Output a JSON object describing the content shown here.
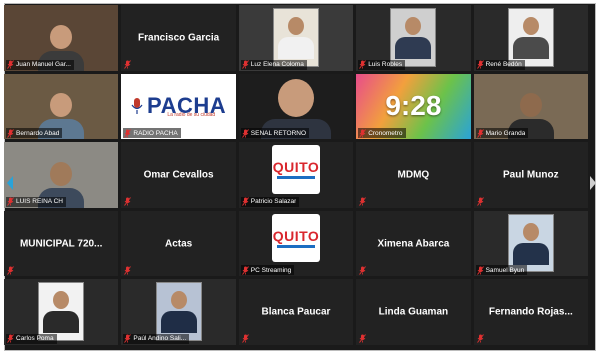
{
  "colors": {
    "tile_bg": "#222222",
    "frame_bg": "#1a1a1a",
    "mic_muted": "#e03131",
    "accent_nav": "#2aa3d8"
  },
  "icons": {
    "muted": "muted-mic-icon",
    "prev": "chevron-left-icon",
    "next": "chevron-right-icon"
  },
  "participants": [
    {
      "label": "Juan Manuel Gar...",
      "kind": "video"
    },
    {
      "name": "Francisco Garcia",
      "kind": "name"
    },
    {
      "label": "Luz Elena Coloma",
      "kind": "video"
    },
    {
      "label": "Luis Robles",
      "kind": "video"
    },
    {
      "label": "René Bedón",
      "kind": "video"
    },
    {
      "label": "Bernardo Abad",
      "kind": "video"
    },
    {
      "label": "RADIO PACHA",
      "kind": "logo",
      "logo": "PACHA",
      "logo_sub": "La radio de su ciudad"
    },
    {
      "label": "SEÑAL RETORNO",
      "kind": "video"
    },
    {
      "label": "Cronometro",
      "kind": "clock",
      "time": "9:28"
    },
    {
      "label": "Mario Granda",
      "kind": "video"
    },
    {
      "label": "LUIS REINA CH",
      "kind": "video"
    },
    {
      "name": "Omar Cevallos",
      "kind": "name"
    },
    {
      "label": "Patricio Salazar",
      "kind": "logo",
      "logo": "QUITO"
    },
    {
      "name": "MDMQ",
      "kind": "name"
    },
    {
      "name": "Paul Munoz",
      "kind": "name"
    },
    {
      "name": "MUNICIPAL 720...",
      "kind": "name"
    },
    {
      "name": "Actas",
      "kind": "name"
    },
    {
      "label": "PC Streaming",
      "kind": "logo",
      "logo": "QUITO"
    },
    {
      "name": "Ximena Abarca",
      "kind": "name"
    },
    {
      "label": "Samuel Byun",
      "kind": "video"
    },
    {
      "label": "Carlos Poma",
      "kind": "video"
    },
    {
      "label": "Paúl Andino Sali...",
      "kind": "video"
    },
    {
      "name": "Blanca Paucar",
      "kind": "name"
    },
    {
      "name": "Linda Guaman",
      "kind": "name"
    },
    {
      "name": "Fernando Rojas...",
      "kind": "name"
    }
  ]
}
